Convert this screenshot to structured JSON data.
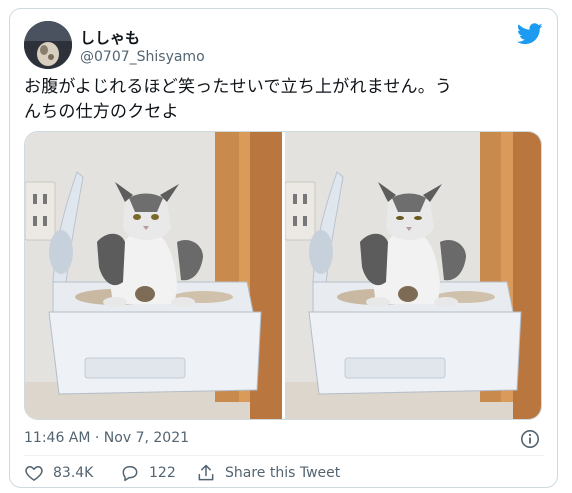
{
  "author": {
    "display_name": "ししゃも",
    "handle": "@0707_Shisyamo"
  },
  "tweet": {
    "text_line1": "お腹がよじれるほど笑ったせいで立ち上がれません。う",
    "text_line2": "んちの仕方のクセよ"
  },
  "meta": {
    "timestamp": "11:46 AM · Nov 7, 2021"
  },
  "actions": {
    "like_count": "83.4K",
    "reply_count": "122",
    "share_label": "Share this Tweet"
  },
  "icons": {
    "brand": "twitter-bird-icon",
    "info": "info-icon",
    "like": "heart-icon",
    "reply": "reply-bubble-icon",
    "share": "share-icon"
  },
  "colors": {
    "brand_blue": "#1d9bf0",
    "secondary_text": "#536471",
    "border": "#cfd9de"
  }
}
